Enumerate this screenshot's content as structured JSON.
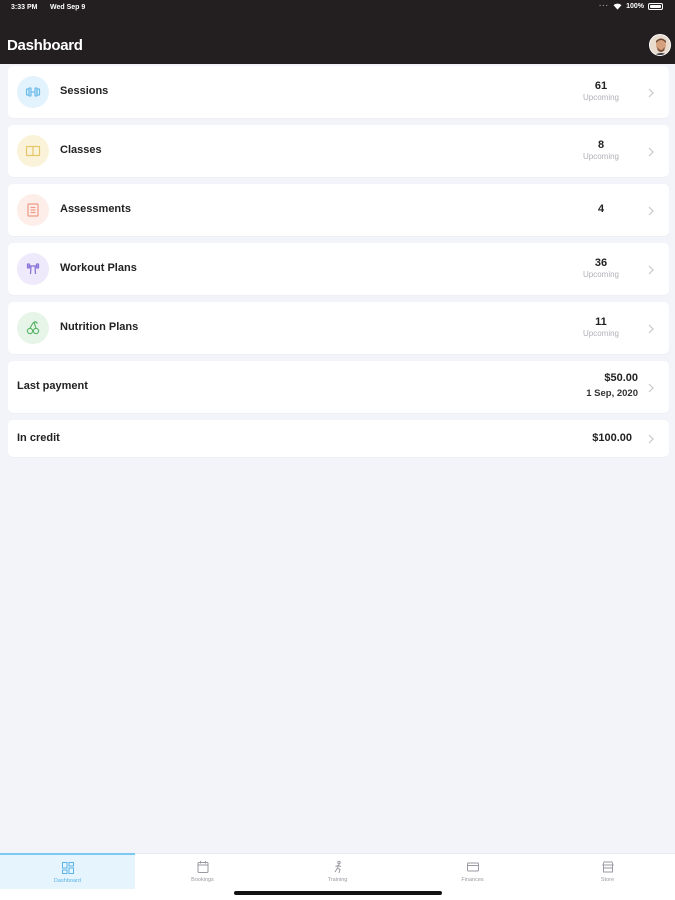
{
  "status_bar": {
    "time": "3:33 PM",
    "date": "Wed Sep 9",
    "battery": "100%"
  },
  "header": {
    "title": "Dashboard"
  },
  "rows": [
    {
      "label": "Sessions",
      "value": "61",
      "sub": "Upcoming",
      "icon": "dumbbell-icon",
      "icon_bg": "#e3f3fd",
      "icon_color": "#6bbbe8"
    },
    {
      "label": "Classes",
      "value": "8",
      "sub": "Upcoming",
      "icon": "board-icon",
      "icon_bg": "#fbf3d9",
      "icon_color": "#e6c66a"
    },
    {
      "label": "Assessments",
      "value": "4",
      "icon": "clipboard-icon",
      "icon_bg": "#fdeeea",
      "icon_color": "#ee9a85"
    },
    {
      "label": "Workout Plans",
      "value": "36",
      "sub": "Upcoming",
      "icon": "barbell-icon",
      "icon_bg": "#eeeafc",
      "icon_color": "#8a76d8"
    },
    {
      "label": "Nutrition Plans",
      "value": "11",
      "sub": "Upcoming",
      "icon": "cherries-icon",
      "icon_bg": "#e6f5e8",
      "icon_color": "#5bb56b"
    }
  ],
  "last_payment": {
    "label": "Last payment",
    "amount": "$50.00",
    "date": "1 Sep, 2020"
  },
  "credit": {
    "label": "In credit",
    "amount": "$100.00"
  },
  "tabs": [
    {
      "label": "Dashboard",
      "icon": "dashboard-icon",
      "active": true
    },
    {
      "label": "Bookings",
      "icon": "calendar-icon",
      "active": false
    },
    {
      "label": "Training",
      "icon": "training-icon",
      "active": false
    },
    {
      "label": "Finances",
      "icon": "card-icon",
      "active": false
    },
    {
      "label": "Store",
      "icon": "store-icon",
      "active": false
    }
  ],
  "colors": {
    "header_bg": "#231f20",
    "page_bg": "#f2f4fa",
    "active_tab": "#5ab4e6"
  }
}
